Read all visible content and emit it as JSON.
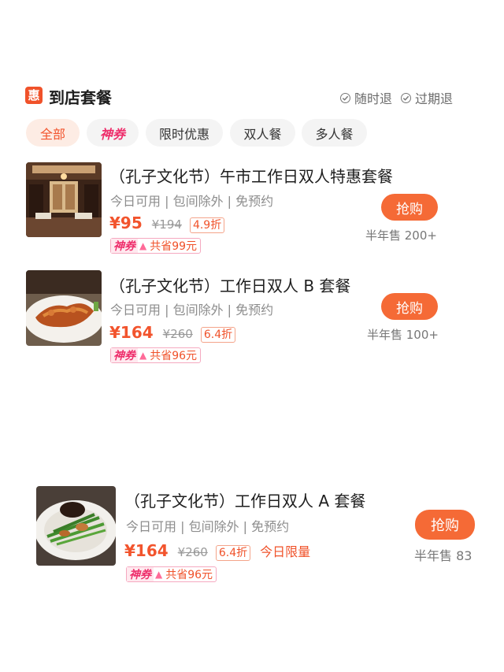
{
  "header": {
    "badge": "惠",
    "title": "到店套餐",
    "policies": [
      "随时退",
      "过期退"
    ]
  },
  "filters": [
    "全部",
    "神券",
    "限时优惠",
    "双人餐",
    "多人餐"
  ],
  "deals": [
    {
      "title": "（孔子文化节）午市工作日双人特惠套餐",
      "desc": "今日可用 | 包间除外 | 免预约",
      "price": "¥95",
      "orig": "¥194",
      "discount": "4.9折",
      "limit": "",
      "coupon_label": "神券",
      "coupon_save": "共省99元",
      "buy": "抢购",
      "sold": "半年售 200+"
    },
    {
      "title": "（孔子文化节）工作日双人 B 套餐",
      "desc": "今日可用 | 包间除外 | 免预约",
      "price": "¥164",
      "orig": "¥260",
      "discount": "6.4折",
      "limit": "",
      "coupon_label": "神券",
      "coupon_save": "共省96元",
      "buy": "抢购",
      "sold": "半年售 100+"
    },
    {
      "title": "（孔子文化节）工作日双人 A 套餐",
      "desc": "今日可用 | 包间除外 | 免预约",
      "price": "¥164",
      "orig": "¥260",
      "discount": "6.4折",
      "limit": "今日限量",
      "coupon_label": "神券",
      "coupon_save": "共省96元",
      "buy": "抢购",
      "sold": "半年售 83"
    }
  ],
  "colors": {
    "accent": "#f2542d",
    "coupon_pink": "#ee2e6b",
    "buy_button": "#f56a36"
  }
}
